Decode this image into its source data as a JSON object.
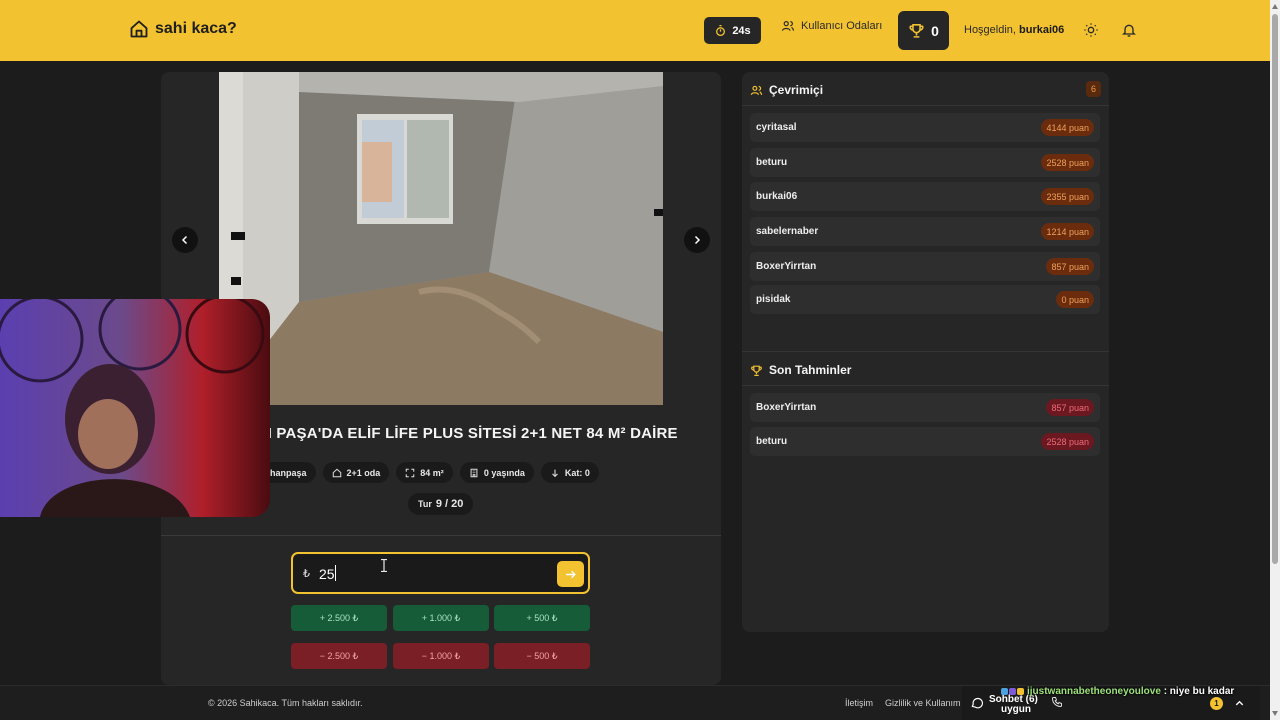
{
  "header": {
    "brand": "sahi kaca?",
    "timer": "24s",
    "rooms_label": "Kullanıcı Odaları",
    "trophy_count": "0",
    "welcome_prefix": "Hoşgeldin,",
    "username": "burkai06"
  },
  "game": {
    "title": "N PAŞA'DA ELİF LİFE PLUS SİTESİ 2+1 NET 84 M² DAİRE",
    "chips": [
      {
        "icon": "location-icon",
        "label": "hanpaşa"
      },
      {
        "icon": "home-icon",
        "label": "2+1 oda"
      },
      {
        "icon": "expand-icon",
        "label": "84 m²"
      },
      {
        "icon": "building-icon",
        "label": "0 yaşında"
      },
      {
        "icon": "arrow-down-icon",
        "label": "Kat: 0"
      }
    ],
    "round_label": "Tur",
    "round_value": "9 / 20",
    "currency": "₺",
    "guess_value": "25",
    "plus_buttons": [
      "+ 2.500 ₺",
      "+ 1.000 ₺",
      "+ 500 ₺"
    ],
    "minus_buttons": [
      "− 2.500 ₺",
      "− 1.000 ₺",
      "− 500 ₺"
    ]
  },
  "online": {
    "title": "Çevrimiçi",
    "count": "6",
    "users": [
      {
        "name": "cyritasal",
        "points": "4144 puan"
      },
      {
        "name": "beturu",
        "points": "2528 puan"
      },
      {
        "name": "burkai06",
        "points": "2355 puan"
      },
      {
        "name": "sabelernaber",
        "points": "1214 puan"
      },
      {
        "name": "BoxerYirrtan",
        "points": "857 puan"
      },
      {
        "name": "pisidak",
        "points": "0 puan"
      }
    ]
  },
  "recent": {
    "title": "Son Tahminler",
    "items": [
      {
        "name": "BoxerYirrtan",
        "points": "857 puan"
      },
      {
        "name": "beturu",
        "points": "2528 puan"
      }
    ]
  },
  "footer": {
    "copyright": "© 2026 Sahikaca. Tüm hakları saklıdır.",
    "contact": "İletişim",
    "privacy": "Gizlilik ve Kullanım",
    "chat_label": "Sohbet (6)",
    "chat_sub": "uygun",
    "chat_badge": "1"
  },
  "stream_chat": {
    "user": "ijustwannabetheoneyoulove",
    "message": ": niye bu kadar"
  },
  "colors": {
    "accent": "#f2c230",
    "plus": "#165c38",
    "minus": "#7a1f26"
  }
}
